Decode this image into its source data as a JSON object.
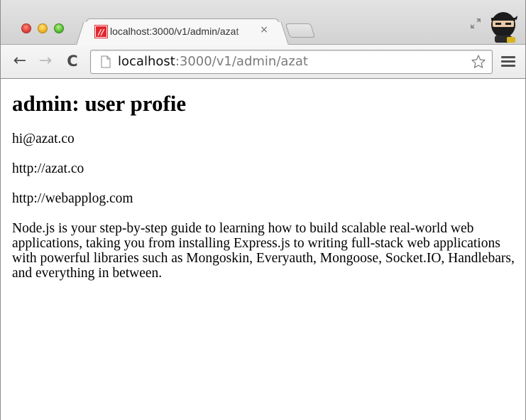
{
  "browser": {
    "tab": {
      "favicon_text": "//",
      "title": "localhost:3000/v1/admin/azat",
      "close_glyph": "×"
    },
    "nav": {
      "back_glyph": "←",
      "forward_glyph": "→",
      "reload_glyph": "C"
    },
    "omnibox": {
      "host": "localhost",
      "path": ":3000/v1/admin/azat"
    },
    "colors": {
      "favicon": "#e2262e",
      "close_button": "#e0443e",
      "minimize_button": "#f1b92c",
      "zoom_button": "#5fc23a"
    },
    "icons": [
      "close-window-icon",
      "minimize-window-icon",
      "zoom-window-icon",
      "fullscreen-icon",
      "ninja-avatar-icon",
      "back-arrow-icon",
      "forward-arrow-icon",
      "reload-icon",
      "page-icon",
      "star-icon",
      "menu-icon"
    ]
  },
  "page": {
    "heading": "admin: user profie",
    "email": "hi@azat.co",
    "website1": "http://azat.co",
    "website2": "http://webapplog.com",
    "bio": "Node.js is your step-by-step guide to learning how to build scalable real-world web applications, taking you from installing Express.js to writing full-stack web applications with powerful libraries such as Mongoskin, Everyauth, Mongoose, Socket.IO, Handlebars, and everything in between."
  }
}
